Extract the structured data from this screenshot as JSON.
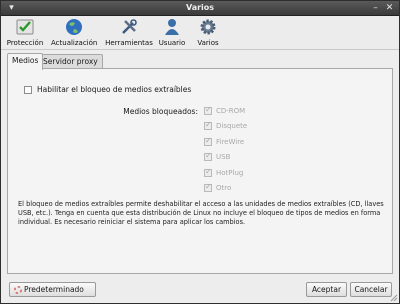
{
  "window": {
    "title": "Varios"
  },
  "toolbar": {
    "items": [
      {
        "label": "Protección",
        "icon": "shield-check-icon"
      },
      {
        "label": "Actualización",
        "icon": "globe-icon"
      },
      {
        "label": "Herramientas",
        "icon": "tools-icon"
      },
      {
        "label": "Usuario",
        "icon": "user-icon"
      },
      {
        "label": "Varios",
        "icon": "gear-icon"
      }
    ]
  },
  "tabs": [
    {
      "label": "Medios",
      "active": true
    },
    {
      "label": "Servidor proxy",
      "active": false
    }
  ],
  "medios": {
    "enable_label": "Habilitar el bloqueo de medios extraíbles",
    "enable_checked": false,
    "blocked_label": "Medios bloqueados:",
    "items": [
      {
        "label": "CD-ROM",
        "checked": true,
        "enabled": false
      },
      {
        "label": "Disquete",
        "checked": true,
        "enabled": false
      },
      {
        "label": "FireWire",
        "checked": true,
        "enabled": false
      },
      {
        "label": "USB",
        "checked": true,
        "enabled": false
      },
      {
        "label": "HotPlug",
        "checked": true,
        "enabled": false
      },
      {
        "label": "Otro",
        "checked": true,
        "enabled": false
      }
    ],
    "description": "El bloqueo de medios extraíbles permite deshabilitar el acceso a las unidades de medios extraíbles (CD, llaves USB, etc.). Tenga en cuenta que esta distribución de Linux no incluye el bloqueo de tipos de medios en forma individual. Es necesario reiniciar el sistema para aplicar los cambios."
  },
  "buttons": {
    "default_label": "Predeterminado",
    "accept_label": "Aceptar",
    "cancel_label": "Cancelar"
  },
  "colors": {
    "titlebar": "#4a4a4a",
    "background": "#ededed",
    "disabled_text": "#a8a8a8"
  }
}
